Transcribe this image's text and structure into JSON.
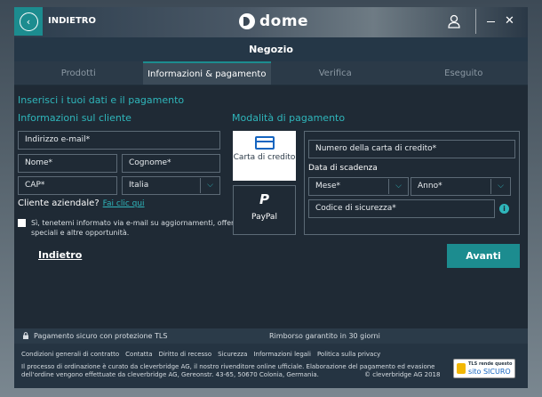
{
  "header": {
    "back_label": "INDIETRO",
    "logo_text": "dome",
    "title": "Negozio"
  },
  "tabs": [
    {
      "label": "Prodotti",
      "active": false
    },
    {
      "label": "Informazioni & pagamento",
      "active": true
    },
    {
      "label": "Verifica",
      "active": false
    },
    {
      "label": "Eseguito",
      "active": false
    }
  ],
  "form": {
    "heading": "Inserisci i tuoi dati e il pagamento",
    "customer_heading": "Informazioni sul cliente",
    "email_placeholder": "Indirizzo e-mail*",
    "firstname_placeholder": "Nome*",
    "lastname_placeholder": "Cognome*",
    "zip_placeholder": "CAP*",
    "country_value": "Italia",
    "business_question": "Cliente aziendale?",
    "business_link": "Fai clic qui",
    "newsletter_text": "Sì, tenetemi informato via e-mail su aggiornamenti, offerte speciali e altre opportunità.",
    "back_link": "Indietro"
  },
  "payment": {
    "heading": "Modalità di pagamento",
    "methods": [
      {
        "label": "Carta di credito",
        "selected": true
      },
      {
        "label": "PayPal",
        "selected": false
      }
    ],
    "card_number_placeholder": "Numero della carta di credito*",
    "expiry_label": "Data di scadenza",
    "month_placeholder": "Mese*",
    "year_placeholder": "Anno*",
    "cvv_placeholder": "Codice di sicurezza*",
    "next_label": "Avanti"
  },
  "footer": {
    "secure_text": "Pagamento sicuro con protezione TLS",
    "refund_text": "Rimborso garantito in 30 giorni",
    "links": [
      "Condizioni generali di contratto",
      "Contatta",
      "Diritto di recesso",
      "Sicurezza",
      "Informazioni legali",
      "Politica sulla privacy"
    ],
    "small_print": "Il processo di ordinazione è curato da cleverbridge AG, il nostro rivenditore online ufficiale. Elaborazione del pagamento ed evasione dell'ordine vengono effettuate da cleverbridge AG, Gereonstr. 43-65, 50670 Colonia, Germania.",
    "copyright": "© cleverbridge AG 2018",
    "badge_top": "TLS rende questo",
    "badge_bottom": "sito SICURO"
  },
  "colors": {
    "accent": "#1c8c8f",
    "heading": "#2fb6bb",
    "background": "#1f2a35"
  },
  "icons": [
    "back-arrow-icon",
    "user-icon",
    "minimize-icon",
    "close-icon",
    "credit-card-icon",
    "paypal-icon",
    "info-icon",
    "lock-icon",
    "chevron-down-icon"
  ]
}
